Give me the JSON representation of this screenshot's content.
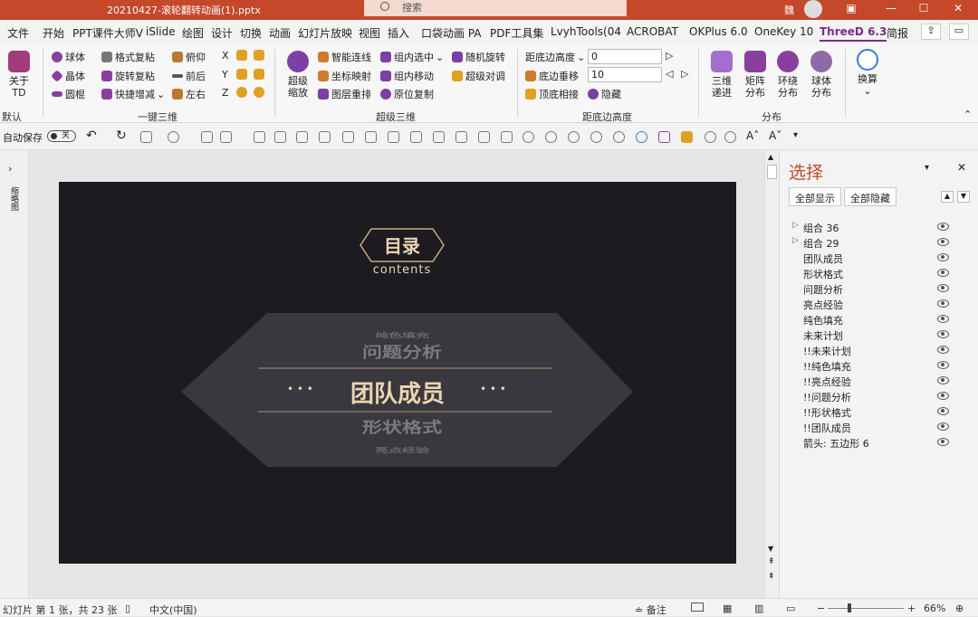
{
  "titlebar": {
    "filename": "20210427-滚轮翻转动画(1).pptx",
    "search": "搜索",
    "user": "魏"
  },
  "menu": [
    "文件",
    "开始",
    "PPT课件大师V",
    "iSlide",
    "绘图",
    "设计",
    "切换",
    "动画",
    "幻灯片放映",
    "视图",
    "插入",
    "口袋动画 PA",
    "PDF工具集",
    "LvyhTools(04",
    "ACROBAT",
    "OKPlus 6.0",
    "OneKey 10",
    "ThreeD 6.3",
    "简报"
  ],
  "ribbon": {
    "about": {
      "label1": "关于",
      "label2": "TD"
    },
    "default_label": "默认",
    "group1": {
      "title": "一键三维",
      "items": [
        "球体",
        "晶体",
        "圆棍",
        "格式复粘",
        "旋转复粘",
        "快捷增减",
        "俯仰",
        "前后",
        "左右"
      ],
      "axes": [
        "X",
        "Y",
        "Z"
      ]
    },
    "group2": {
      "title": "超级三维",
      "zoom1": "超级",
      "zoom2": "缩放",
      "items": [
        "智能连线",
        "坐标映射",
        "图层重排",
        "组内选中",
        "组内移动",
        "原位复制",
        "随机旋转",
        "超级对调"
      ]
    },
    "group3": {
      "title": "距底边高度",
      "items": [
        "距底边高度",
        "底边垂移",
        "顶底相接",
        "隐藏"
      ],
      "value1": "0",
      "value2": "10"
    },
    "group4": {
      "title": "分布",
      "items": [
        [
          "三维",
          "递进"
        ],
        [
          "矩阵",
          "分布"
        ],
        [
          "环绕",
          "分布"
        ],
        [
          "球体",
          "分布"
        ]
      ]
    },
    "convert": "换算"
  },
  "qat": {
    "autosave": "自动保存",
    "toggle": "关"
  },
  "thumb_label": "缩略图",
  "slide": {
    "title": "目录",
    "subtitle": "contents",
    "center": "团队成员",
    "dots": "• • •",
    "ghost_above": "问题分析",
    "ghost_below": "形状格式",
    "ghost_top": "纯色填充",
    "ghost_bottom": "亮点经验"
  },
  "pane": {
    "title": "选择",
    "show_all": "全部显示",
    "hide_all": "全部隐藏",
    "items": [
      "组合 36",
      "组合 29",
      "团队成员",
      "形状格式",
      "问题分析",
      "亮点经验",
      "纯色填充",
      "未来计划",
      "!!未来计划",
      "!!纯色填充",
      "!!亮点经验",
      "!!问题分析",
      "!!形状格式",
      "!!团队成员",
      "箭头: 五边形 6"
    ]
  },
  "status": {
    "slide": "幻灯片 第 1 张，共 23 张",
    "lang": "中文(中国)",
    "notes": "备注",
    "zoom": "66%"
  }
}
